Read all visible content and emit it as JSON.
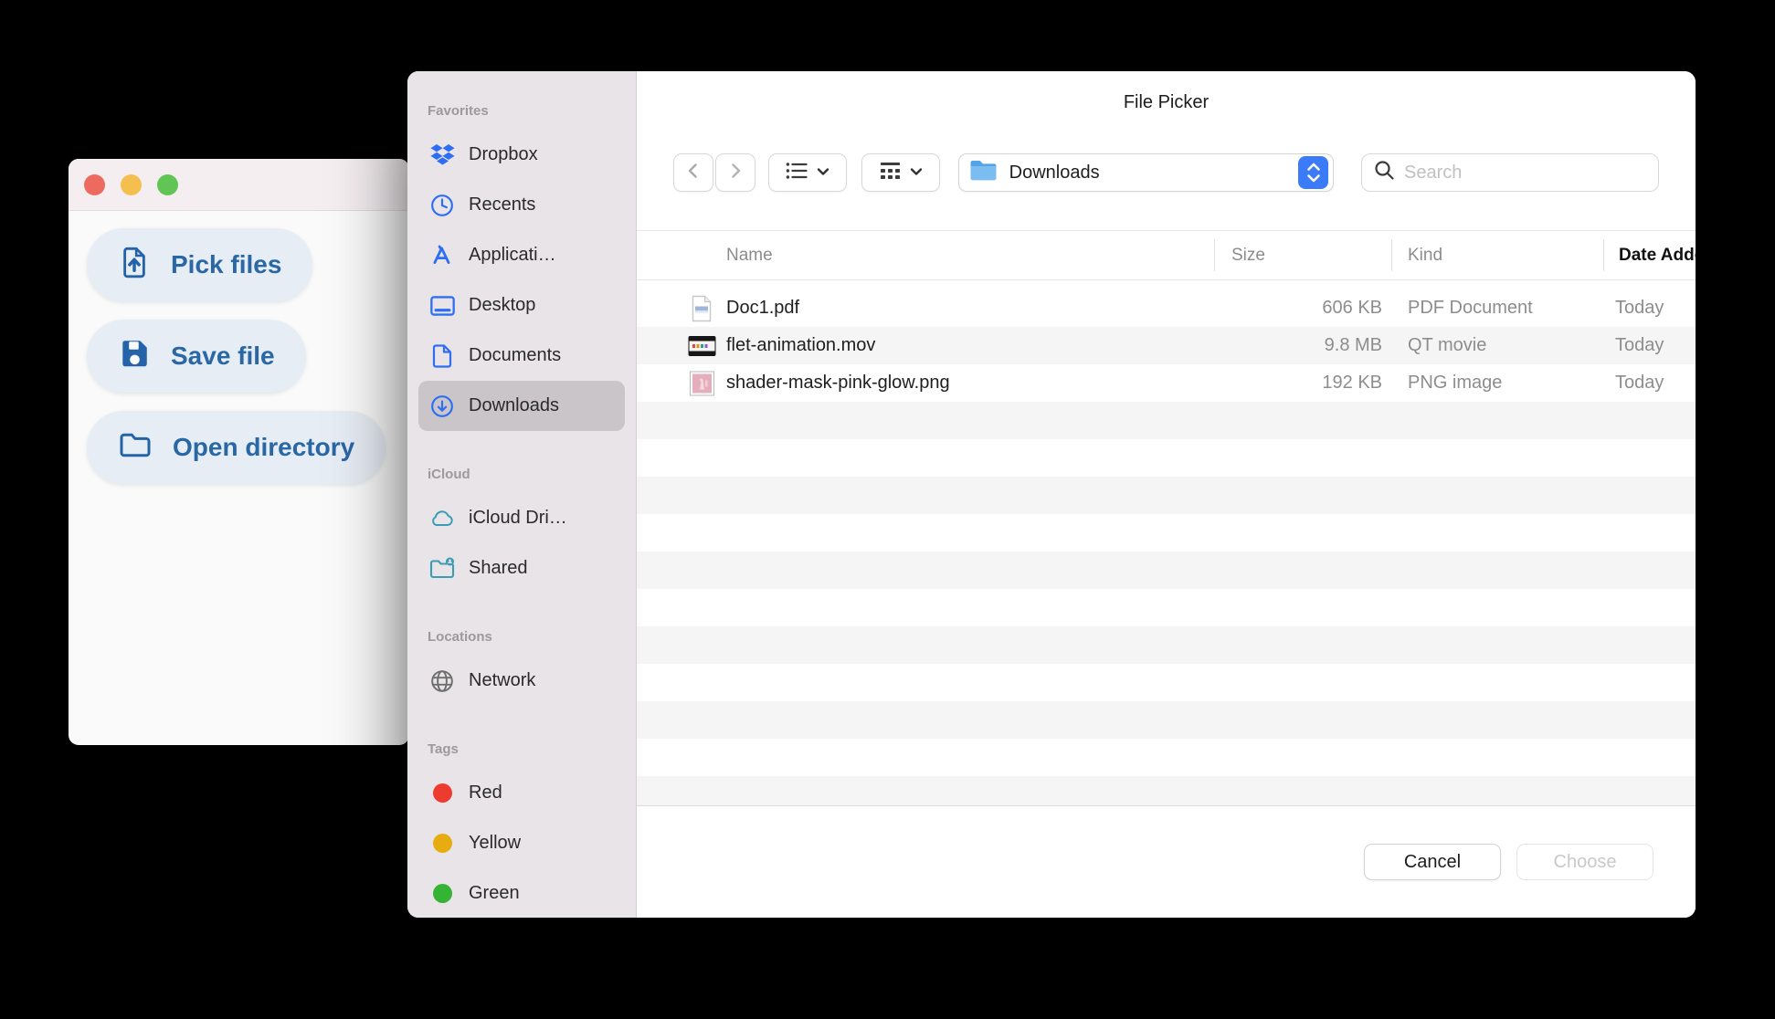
{
  "app_window": {
    "buttons": [
      {
        "label": "Pick files"
      },
      {
        "label": "Save file"
      },
      {
        "label": "Open directory"
      }
    ]
  },
  "dialog": {
    "title": "File Picker",
    "toolbar": {
      "path_label": "Downloads",
      "search_placeholder": "Search"
    },
    "sidebar": {
      "sections": [
        {
          "title": "Favorites",
          "items": [
            {
              "label": "Dropbox"
            },
            {
              "label": "Recents"
            },
            {
              "label": "Applicati…"
            },
            {
              "label": "Desktop"
            },
            {
              "label": "Documents"
            },
            {
              "label": "Downloads",
              "selected": true
            }
          ]
        },
        {
          "title": "iCloud",
          "items": [
            {
              "label": "iCloud Dri…"
            },
            {
              "label": "Shared"
            }
          ]
        },
        {
          "title": "Locations",
          "items": [
            {
              "label": "Network"
            }
          ]
        },
        {
          "title": "Tags",
          "items": [
            {
              "label": "Red",
              "color": "#ee3b30"
            },
            {
              "label": "Yellow",
              "color": "#e7ad10"
            },
            {
              "label": "Green",
              "color": "#35b335"
            }
          ]
        }
      ]
    },
    "table": {
      "columns": [
        "Name",
        "Size",
        "Kind",
        "Date Added"
      ],
      "sort_column": "Date Added",
      "rows": [
        {
          "name": "Doc1.pdf",
          "size": "606 KB",
          "kind": "PDF Document",
          "date": "Today"
        },
        {
          "name": "flet-animation.mov",
          "size": "9.8 MB",
          "kind": "QT movie",
          "date": "Today"
        },
        {
          "name": "shader-mask-pink-glow.png",
          "size": "192 KB",
          "kind": "PNG image",
          "date": "Today"
        }
      ]
    },
    "footer": {
      "cancel_label": "Cancel",
      "choose_label": "Choose"
    }
  },
  "colors": {
    "accent_blue": "#3b7bf7",
    "sidebar_icon_blue": "#2e6ef5",
    "icloud_teal": "#3d9cb5",
    "app_button_blue": "#2563a8",
    "sidebar_bg": "#e9e4e7",
    "selection_gray": "#c9c5c8",
    "stripe_gray": "#f5f5f6",
    "tag_red": "#ee3b30",
    "tag_yellow": "#e7ad10",
    "tag_green": "#35b335",
    "traffic_red": "#ed6a5e",
    "traffic_yellow": "#f5bf4f",
    "traffic_green": "#61c555"
  }
}
